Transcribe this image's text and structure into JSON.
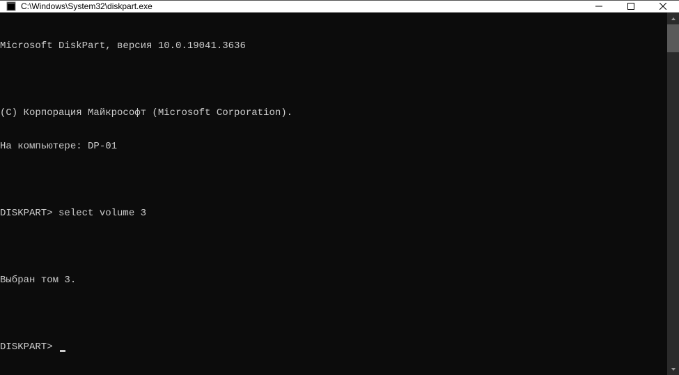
{
  "window": {
    "title": "C:\\Windows\\System32\\diskpart.exe"
  },
  "console": {
    "lines": [
      "Microsoft DiskPart, версия 10.0.19041.3636",
      "",
      "(C) Корпорация Майкрософт (Microsoft Corporation).",
      "На компьютере: DP-01",
      "",
      "DISKPART> select volume 3",
      "",
      "Выбран том 3.",
      "",
      "DISKPART> "
    ],
    "prompt": "DISKPART>"
  }
}
